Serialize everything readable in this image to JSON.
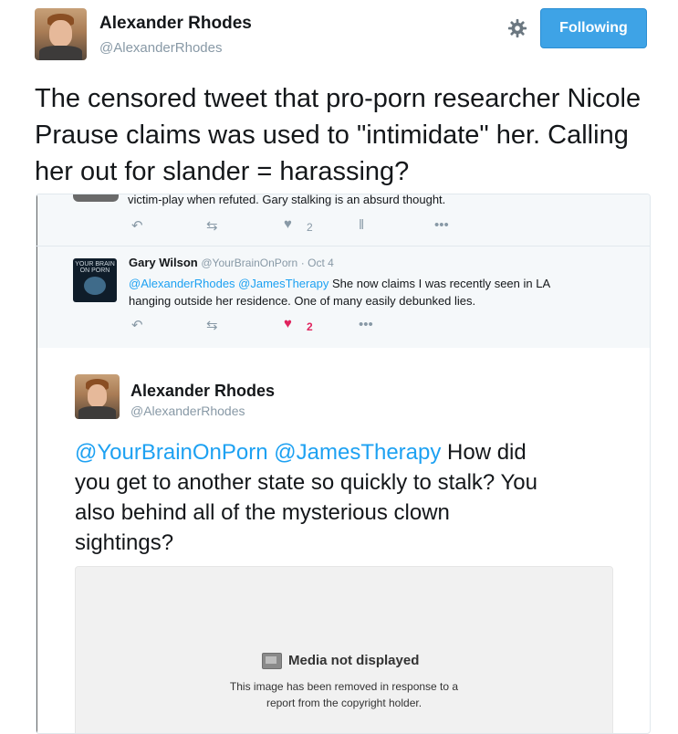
{
  "header": {
    "name": "Alexander Rhodes",
    "handle": "@AlexanderRhodes",
    "follow_label": "Following"
  },
  "tweet": {
    "text": "The censored tweet that pro-porn researcher Nicole Prause claims was used to \"intimidate\" her. Calling her out for slander = harassing?"
  },
  "embed": {
    "prev_snippet": "victim-play when refuted. Gary stalking is an absurd thought.",
    "prev_like_count": "2",
    "reply": {
      "avatar_text": "YOUR BRAIN ON PORN",
      "name": "Gary Wilson",
      "handle": "@YourBrainOnPorn",
      "date": "· Oct 4",
      "mentions": "@AlexanderRhodes @JamesTherapy",
      "text_line1": "She now claims I was recently seen in LA",
      "text_line2": "hanging outside her residence. One of many easily debunked lies.",
      "like_count": "2"
    },
    "quoted": {
      "name": "Alexander Rhodes",
      "handle": "@AlexanderRhodes",
      "mentions": "@YourBrainOnPorn @JamesTherapy",
      "text_rest": "How did",
      "text_line2": "you get to another state so quickly to stalk? You",
      "text_line3": "also behind all of the mysterious clown",
      "text_line4": "sightings?",
      "media_title": "Media not displayed",
      "media_line1": "This image has been removed in response to a",
      "media_line2": "report from the copyright holder."
    }
  },
  "colors": {
    "accent": "#1da1f2",
    "follow_button": "#3ea3e6",
    "like_active": "#e0245e",
    "muted": "#8899a6"
  },
  "icons": [
    "gear-icon",
    "reply-icon",
    "retweet-icon",
    "heart-icon",
    "analytics-icon",
    "more-icon",
    "media-icon"
  ]
}
